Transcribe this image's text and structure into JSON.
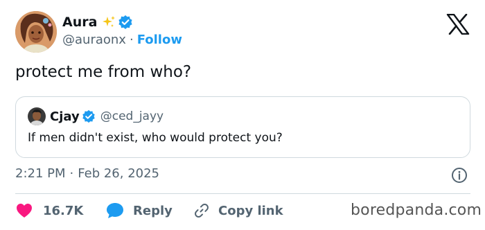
{
  "author": {
    "name": "Aura",
    "handle": "@auraonx",
    "follow_label": "Follow",
    "separator": "·"
  },
  "tweet": {
    "text": "protect me from who?"
  },
  "quoted": {
    "name": "Cjay",
    "handle": "@ced_jayy",
    "text": "If men didn't exist, who would protect you?"
  },
  "meta": {
    "time": "2:21 PM",
    "separator": "·",
    "date": "Feb 26, 2025"
  },
  "actions": {
    "likes": "16.7K",
    "reply_label": "Reply",
    "copy_label": "Copy link"
  },
  "watermark": "boredpanda.com",
  "icons": {
    "brand": "x-logo-icon",
    "verified": "verified-badge-icon",
    "sparkle": "sparkles-icon",
    "info": "info-icon",
    "like": "heart-icon",
    "reply": "speech-bubble-icon",
    "copy": "link-icon"
  },
  "colors": {
    "accent": "#1d9bf0",
    "like": "#f91880",
    "text": "#0f1419",
    "muted": "#536471",
    "border": "#cfd9de",
    "sparkle": "#f5c518"
  }
}
